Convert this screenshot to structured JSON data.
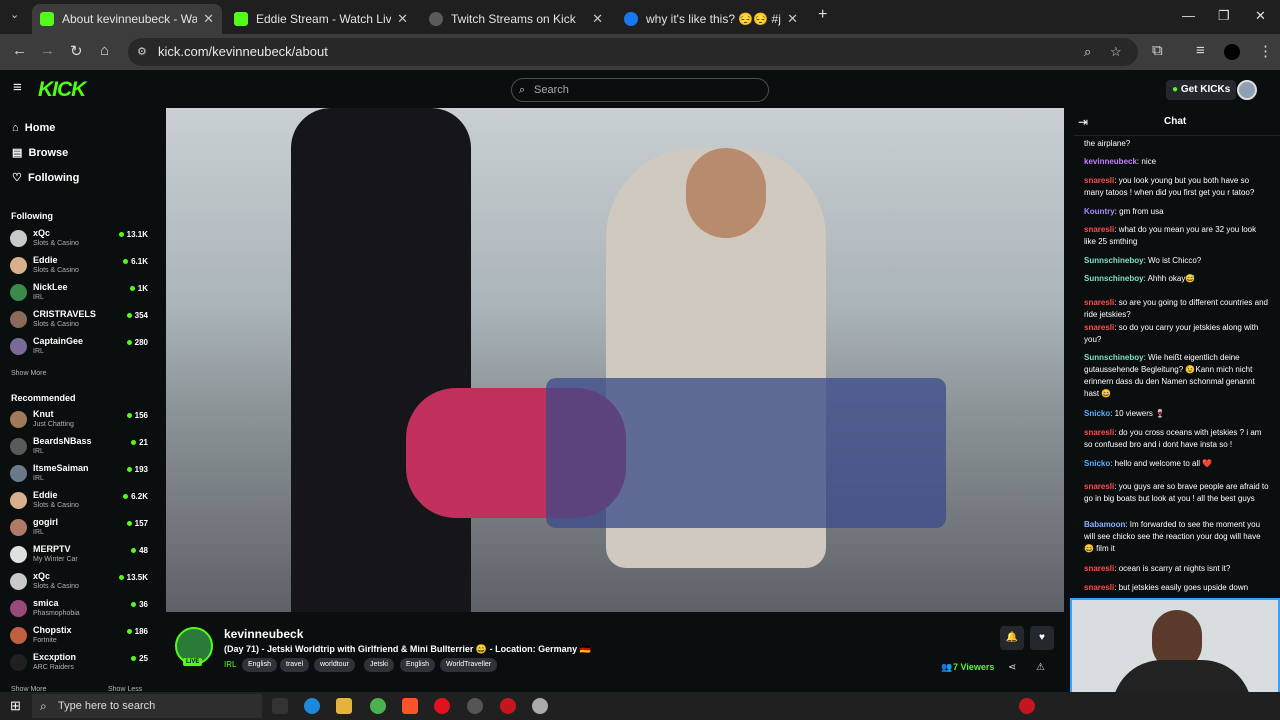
{
  "browser": {
    "tabs": [
      {
        "title": "About kevinneubeck - Watch Live on Kick",
        "active": true
      },
      {
        "title": "Eddie Stream - Watch Live on Kick",
        "active": false
      },
      {
        "title": "Twitch Streams on Kick",
        "active": false
      },
      {
        "title": "why it's like this? 😔😔 #jetski #bala",
        "active": false
      }
    ],
    "url": "kick.com/kevinneubeck/about",
    "new_tab": "+"
  },
  "kick": {
    "logo": "KICK",
    "search_placeholder": "Search",
    "get_kicks": "Get KICKs"
  },
  "sidebar": {
    "nav": [
      {
        "label": "Home",
        "icon": "home-icon"
      },
      {
        "label": "Browse",
        "icon": "browse-icon"
      },
      {
        "label": "Following",
        "icon": "heart-icon"
      }
    ],
    "following_title": "Following",
    "following": [
      {
        "name": "xQc",
        "category": "Slots & Casino",
        "viewers": "13.1K",
        "color": "#c9c9c9"
      },
      {
        "name": "Eddie",
        "category": "Slots & Casino",
        "viewers": "6.1K",
        "color": "#d9b08c"
      },
      {
        "name": "NickLee",
        "category": "IRL",
        "viewers": "1K",
        "color": "#3a8a4a"
      },
      {
        "name": "CRISTRAVELS",
        "category": "Slots & Casino",
        "viewers": "354",
        "color": "#8a6a5a"
      },
      {
        "name": "CaptainGee",
        "category": "IRL",
        "viewers": "280",
        "color": "#7a6a9a"
      }
    ],
    "show_more": "Show More",
    "recommended_title": "Recommended",
    "recommended": [
      {
        "name": "Knut",
        "category": "Just Chatting",
        "viewers": "156",
        "color": "#a07a5a"
      },
      {
        "name": "BeardsNBass",
        "category": "IRL",
        "viewers": "21",
        "color": "#5a5a5a"
      },
      {
        "name": "ItsmeSaiman",
        "category": "IRL",
        "viewers": "193",
        "color": "#6a7a8a"
      },
      {
        "name": "Eddie",
        "category": "Slots & Casino",
        "viewers": "6.2K",
        "color": "#d9b08c"
      },
      {
        "name": "gogirl",
        "category": "IRL",
        "viewers": "157",
        "color": "#b07a6a"
      },
      {
        "name": "MERPTV",
        "category": "My Winter Car",
        "viewers": "48",
        "color": "#e0e0e0"
      },
      {
        "name": "xQc",
        "category": "Slots & Casino",
        "viewers": "13.5K",
        "color": "#c9c9c9"
      },
      {
        "name": "smica",
        "category": "Phasmophobia",
        "viewers": "36",
        "color": "#9a4a7a"
      },
      {
        "name": "Chopstix",
        "category": "Fortnite",
        "viewers": "186",
        "color": "#c06040"
      },
      {
        "name": "Excxption",
        "category": "ARC Raiders",
        "viewers": "25",
        "color": "#202020"
      }
    ],
    "show_more_bottom": "Show More",
    "show_less": "Show Less"
  },
  "stream": {
    "streamer": "kevinneubeck",
    "live": "LIVE",
    "title": "(Day 71) - Jetski Worldtrip with Girlfriend & Mini Bullterrier 😄 - Location: Germany 🇩🇪",
    "category": "IRL",
    "tags": [
      "English",
      "travel",
      "worldtour",
      "Jetski",
      "English",
      "WorldTraveller"
    ],
    "viewers": "7 Viewers"
  },
  "chat": {
    "title": "Chat",
    "messages": [
      {
        "user": "",
        "text": "the airplane?",
        "color": "#ffffff"
      },
      {
        "user": "kevinneubeck",
        "text": ": nice",
        "color": "#c77dff"
      },
      {
        "user": "snaresli",
        "text": ": you look young but you both have so many tatoos ! when did you first get you r tatoo?",
        "color": "#ff4d4d"
      },
      {
        "user": "Kountry",
        "text": ": gm from usa",
        "color": "#a78bfa"
      },
      {
        "user": "snaresli",
        "text": ": what do you mean you are 32 you look like 25 smthing",
        "color": "#ff4d4d"
      },
      {
        "user": "Sunnschineboy",
        "text": ": Wo ist Chicco?",
        "color": "#7ee0c8"
      },
      {
        "user": "Sunnschineboy",
        "text": ": Ahhh okay😅",
        "color": "#7ee0c8"
      },
      {
        "user": "snaresli",
        "text": ": so are you going to different countries and ride jetskies?",
        "color": "#ff4d4d"
      },
      {
        "user": "snaresli",
        "text": ": so do you carry your jetskies along with you?",
        "color": "#ff4d4d"
      },
      {
        "user": "Sunnschineboy",
        "text": ": Wie heißt eigentlich deine gutaussehende Begleitung? 😉Kann mich nicht erinnern dass du den Namen schonmal genannt hast 😄",
        "color": "#7ee0c8"
      },
      {
        "user": "Snicko",
        "text": ": 10 viewers 🍷",
        "color": "#5ab0ff"
      },
      {
        "user": "snaresli",
        "text": ": do you cross oceans with jetskies ? i am so confused bro and i dont have insta so !",
        "color": "#ff4d4d"
      },
      {
        "user": "Snicko",
        "text": ": hello and welcome to all ❤️",
        "color": "#5ab0ff"
      },
      {
        "user": "snaresli",
        "text": ": you guys are so brave people are afraid to go in big boats but look at you ! all the best guys",
        "color": "#ff4d4d"
      },
      {
        "user": "Babamoon",
        "text": ": Im forwarded to see the moment you will see chicko see the reaction your dog will have 😄 film it",
        "color": "#8ab4ff"
      },
      {
        "user": "snaresli",
        "text": ": ocean is scarry at nights isnt it?",
        "color": "#ff4d4d"
      },
      {
        "user": "snaresli",
        "text": ": but jetskies easily goes upside down",
        "color": "#ff4d4d"
      }
    ]
  },
  "taskbar": {
    "search_placeholder": "Type here to search"
  },
  "colors": {
    "accent": "#53fc18",
    "background": "#0b0e0f"
  }
}
